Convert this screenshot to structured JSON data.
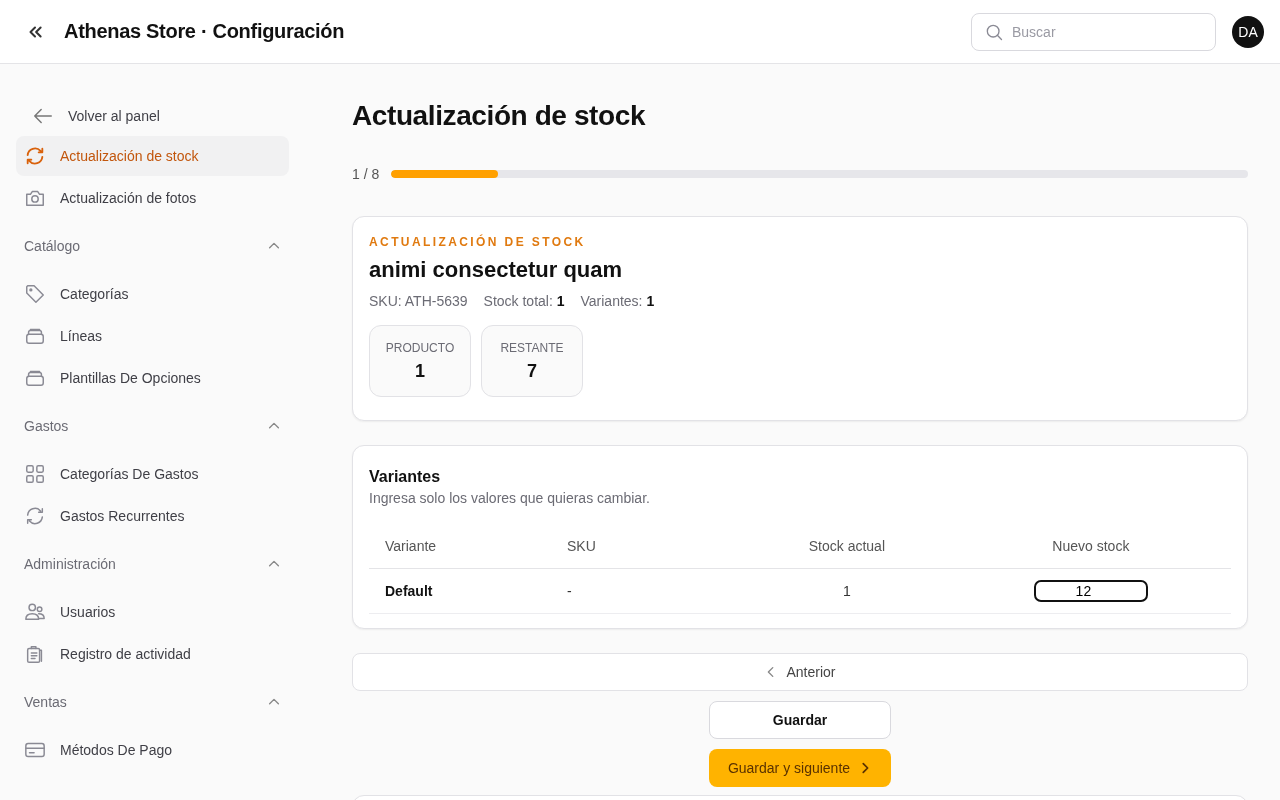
{
  "header": {
    "title": "Athenas Store · Configuración",
    "search": {
      "placeholder": "Buscar"
    },
    "avatar": "DA"
  },
  "sidebar": {
    "back": "Volver al panel",
    "items": [
      {
        "label": "Actualización de stock",
        "kind": "refresh",
        "selected": true
      },
      {
        "label": "Actualización de fotos",
        "kind": "camera",
        "selected": false
      }
    ],
    "sections": [
      {
        "title": "Catálogo",
        "expanded": true,
        "items": [
          {
            "label": "Categorías",
            "kind": "tag",
            "selected": false
          },
          {
            "label": "Líneas",
            "kind": "stack",
            "selected": false
          },
          {
            "label": "Plantillas De Opciones",
            "kind": "stack",
            "selected": false
          }
        ]
      },
      {
        "title": "Gastos",
        "expanded": true,
        "items": [
          {
            "label": "Categorías De Gastos",
            "kind": "grid",
            "selected": false
          },
          {
            "label": "Gastos Recurrentes",
            "kind": "refresh",
            "selected": false
          }
        ]
      },
      {
        "title": "Administración",
        "expanded": true,
        "items": [
          {
            "label": "Usuarios",
            "kind": "users",
            "selected": false
          },
          {
            "label": "Registro de actividad",
            "kind": "clipboard",
            "selected": false
          }
        ]
      },
      {
        "title": "Ventas",
        "expanded": true,
        "items": [
          {
            "label": "Métodos De Pago",
            "kind": "card",
            "selected": false
          }
        ]
      }
    ]
  },
  "page": {
    "title": "Actualización de stock",
    "progress": {
      "label": "1 / 8",
      "level": 0.125
    },
    "product": {
      "eyebrow": "ACTUALIZACIÓN DE STOCK",
      "name": "animi consectetur quam",
      "meta": [
        "SKU: ATH-5639",
        "Stock total: **1**",
        "Variantes: **1**"
      ],
      "stats": [
        {
          "label": "PRODUCTO",
          "value": "1"
        },
        {
          "label": "RESTANTE",
          "value": "7"
        }
      ]
    },
    "variants": {
      "title": "Variantes",
      "hint": "Ingresa solo los valores que quieras cambiar.",
      "columns": [
        "Variante",
        "SKU",
        "Stock actual",
        "Nuevo stock"
      ],
      "rows": [
        {
          "variant": "Default",
          "sku": "-",
          "stock": "1",
          "new_stock": "12"
        }
      ]
    },
    "previous": "Anterior",
    "save": "Guardar",
    "save_next": "Guardar y siguiente"
  }
}
